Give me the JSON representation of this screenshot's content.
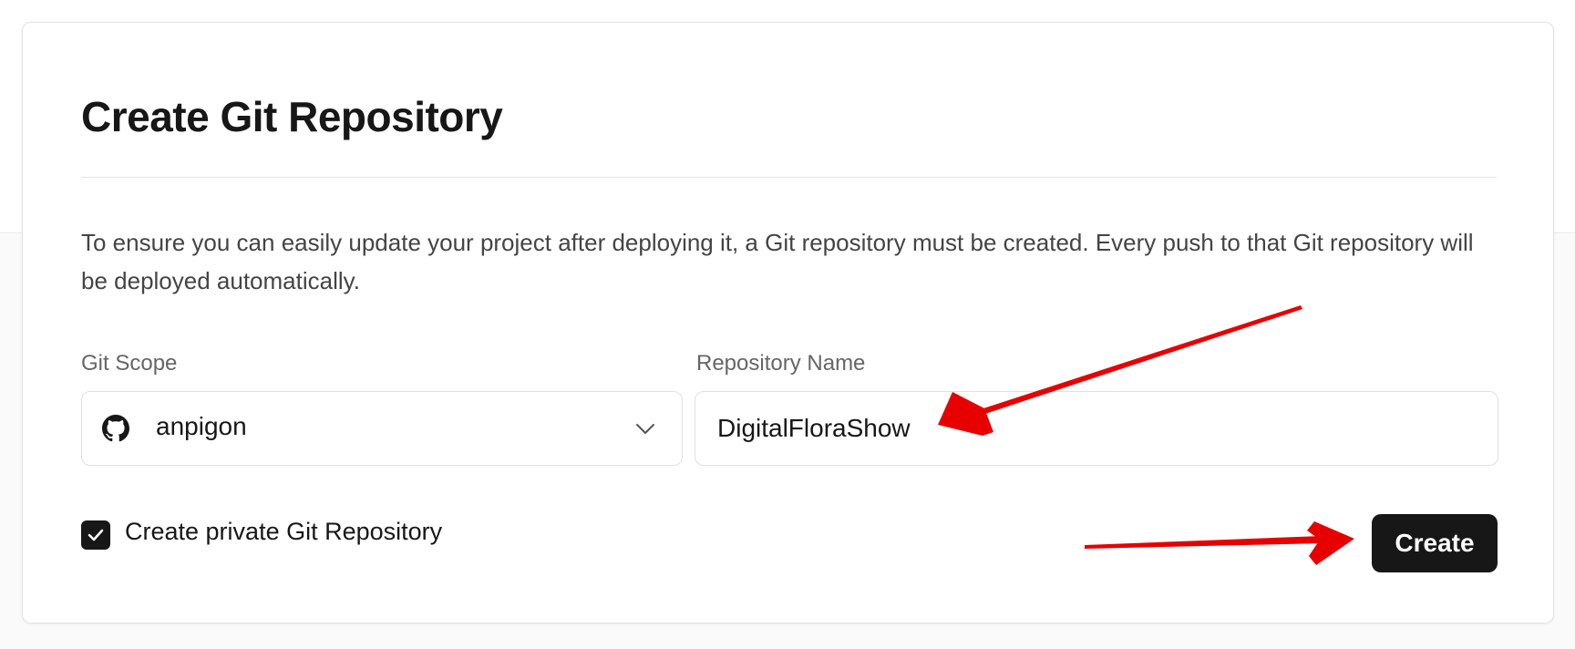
{
  "dialog": {
    "title": "Create Git Repository",
    "description": "To ensure you can easily update your project after deploying it, a Git repository must be created. Every push to that Git repository will be deployed automatically."
  },
  "git_scope": {
    "label": "Git Scope",
    "selected": "anpigon",
    "icon": "github-icon"
  },
  "repository_name": {
    "label": "Repository Name",
    "value": "DigitalFloraShow"
  },
  "private_checkbox": {
    "label": "Create private Git Repository",
    "checked": true
  },
  "actions": {
    "create_label": "Create"
  },
  "colors": {
    "primary": "#171717",
    "annotation_arrow": "#e60000"
  }
}
